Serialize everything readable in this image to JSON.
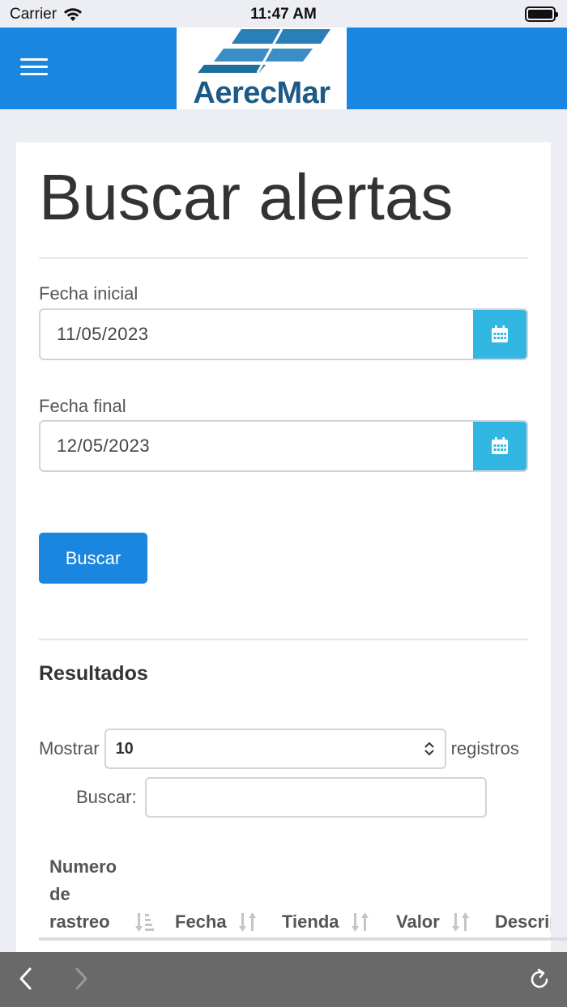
{
  "status_bar": {
    "carrier": "Carrier",
    "time": "11:47 AM"
  },
  "navbar": {
    "logo_text": "AerecMar",
    "menu_icon": "hamburger-menu-icon"
  },
  "page": {
    "title": "Buscar alertas",
    "start_date": {
      "label": "Fecha inicial",
      "value": "11/05/2023",
      "icon": "calendar-icon"
    },
    "end_date": {
      "label": "Fecha final",
      "value": "12/05/2023",
      "icon": "calendar-icon"
    },
    "search_button": "Buscar",
    "results_heading": "Resultados",
    "show": {
      "prefix": "Mostrar",
      "value": "10",
      "suffix": "registros"
    },
    "filter": {
      "label": "Buscar:",
      "value": ""
    },
    "table": {
      "columns": [
        "Numero de rastreo",
        "Fecha",
        "Tienda",
        "Valor",
        "Descripción"
      ]
    }
  },
  "bottom_bar": {
    "back_icon": "chevron-left-icon",
    "forward_icon": "chevron-right-icon",
    "reload_icon": "reload-icon"
  },
  "colors": {
    "primary": "#1a86e0",
    "calendar_button": "#32b7e3",
    "background": "#eceef3"
  }
}
